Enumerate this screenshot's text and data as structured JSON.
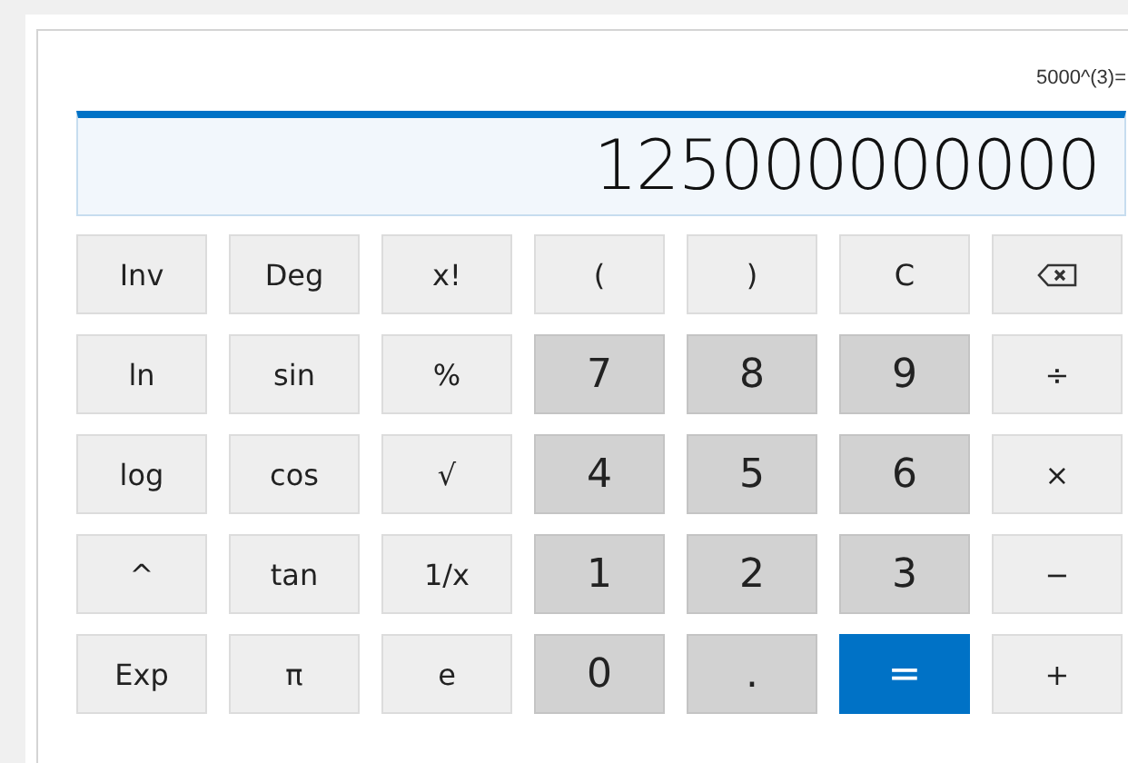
{
  "expression": "5000^(3)=",
  "display": "125000000000",
  "keys": [
    {
      "kind": "func",
      "label": "Inv"
    },
    {
      "kind": "func",
      "label": "Deg"
    },
    {
      "kind": "func",
      "label": "x!"
    },
    {
      "kind": "func",
      "label": "("
    },
    {
      "kind": "func",
      "label": ")"
    },
    {
      "kind": "func",
      "label": "C"
    },
    {
      "kind": "backspace"
    },
    {
      "kind": "func",
      "label": "ln"
    },
    {
      "kind": "func",
      "label": "sin"
    },
    {
      "kind": "func",
      "label": "%"
    },
    {
      "kind": "digit",
      "label": "7"
    },
    {
      "kind": "digit",
      "label": "8"
    },
    {
      "kind": "digit",
      "label": "9"
    },
    {
      "kind": "func",
      "label": "÷"
    },
    {
      "kind": "func",
      "label": "log"
    },
    {
      "kind": "func",
      "label": "cos"
    },
    {
      "kind": "func",
      "label": "√"
    },
    {
      "kind": "digit",
      "label": "4"
    },
    {
      "kind": "digit",
      "label": "5"
    },
    {
      "kind": "digit",
      "label": "6"
    },
    {
      "kind": "func",
      "label": "×"
    },
    {
      "kind": "func",
      "label": "^"
    },
    {
      "kind": "func",
      "label": "tan"
    },
    {
      "kind": "func",
      "label": "1/x"
    },
    {
      "kind": "digit",
      "label": "1"
    },
    {
      "kind": "digit",
      "label": "2"
    },
    {
      "kind": "digit",
      "label": "3"
    },
    {
      "kind": "func",
      "label": "−"
    },
    {
      "kind": "func",
      "label": "Exp"
    },
    {
      "kind": "func",
      "label": "π"
    },
    {
      "kind": "func",
      "label": "e"
    },
    {
      "kind": "digit",
      "label": "0"
    },
    {
      "kind": "digit",
      "label": "."
    },
    {
      "kind": "equals",
      "label": "="
    },
    {
      "kind": "func",
      "label": "+"
    }
  ]
}
